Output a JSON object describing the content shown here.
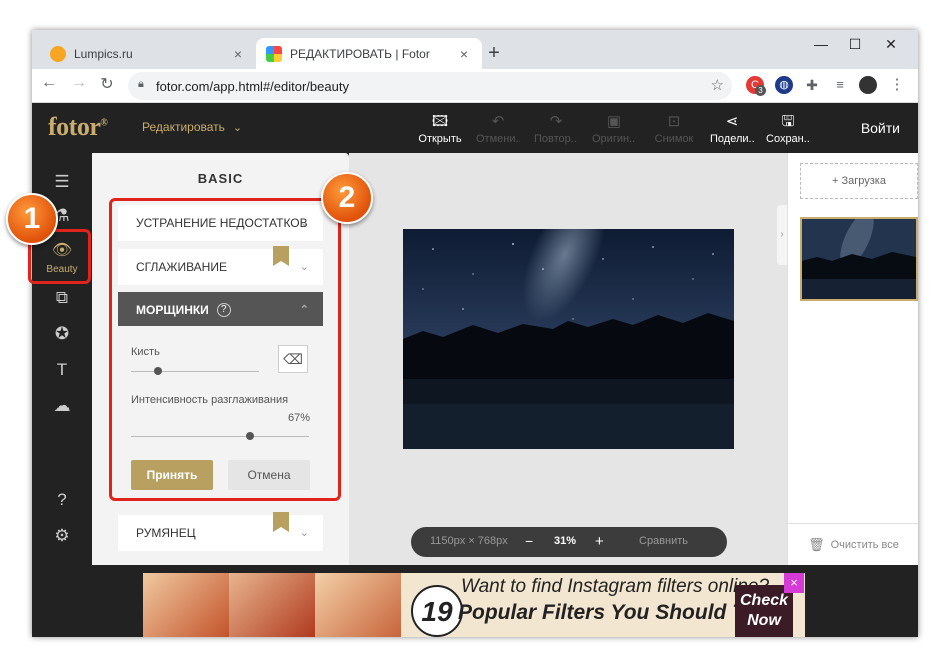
{
  "browser": {
    "tabs": [
      {
        "title": "Lumpics.ru",
        "favicon_color": "#f6a623"
      },
      {
        "title": "РЕДАКТИРОВАТЬ | Fotor",
        "favicon_color": "#e64a8a"
      }
    ],
    "url": "fotor.com/app.html#/editor/beauty",
    "extension_badge": "3"
  },
  "app": {
    "logo": "fotor",
    "logo_mark": "®",
    "edit_menu": "Редактировать",
    "tools": [
      {
        "label": "Открыть",
        "icon": "open-icon",
        "enabled": true
      },
      {
        "label": "Отмени...",
        "icon": "undo-icon",
        "enabled": false
      },
      {
        "label": "Повтор...",
        "icon": "redo-icon",
        "enabled": false
      },
      {
        "label": "Оригин...",
        "icon": "original-icon",
        "enabled": false
      },
      {
        "label": "Снимок",
        "icon": "snapshot-icon",
        "enabled": false
      },
      {
        "label": "Подели...",
        "icon": "share-icon",
        "enabled": true
      },
      {
        "label": "Сохран...",
        "icon": "save-icon",
        "enabled": true
      }
    ],
    "login": "Войти"
  },
  "sidebar": {
    "active_label": "Beauty"
  },
  "panel": {
    "title": "BASIC",
    "sections": [
      {
        "label": "УСТРАНЕНИЕ НЕДОСТАТКОВ",
        "premium": false
      },
      {
        "label": "СГЛАЖИВАНИЕ",
        "premium": true
      },
      {
        "label": "МОРЩИНКИ",
        "open": true
      },
      {
        "label": "РУМЯНЕЦ",
        "premium": true
      }
    ],
    "brush_label": "Кисть",
    "brush_level": 0.12,
    "intensity_label": "Интенсивность разглаживания",
    "intensity_value": "67%",
    "intensity_level": 0.67,
    "accept": "Принять",
    "cancel": "Отмена"
  },
  "canvas": {
    "dimensions": "1150px × 768px",
    "zoom": "31%",
    "zoom_minus": "−",
    "zoom_plus": "+",
    "compare": "Сравнить"
  },
  "right": {
    "upload": "+ Загрузка",
    "clear_all": "Очистить все"
  },
  "ad": {
    "number": "19",
    "line1": "Want to find Instagram filters online?",
    "line2": "Popular Filters You Should Try",
    "cta": "Check Now",
    "close": "×"
  },
  "annotations": [
    "1",
    "2"
  ]
}
